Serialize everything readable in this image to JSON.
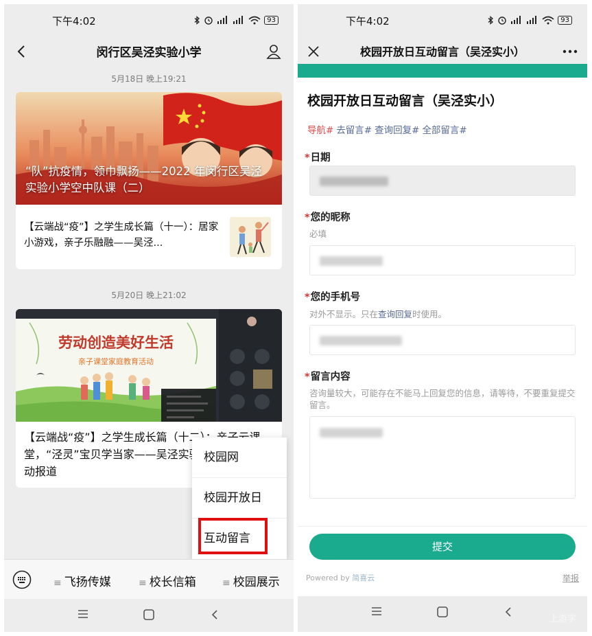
{
  "status_bar": {
    "time": "下午4:02",
    "battery": "93"
  },
  "left_screen": {
    "header": {
      "title": "闵行区吴泾实验小学"
    },
    "messages": [
      {
        "timestamp": "5月18日 晚上19:21",
        "hero_title": "“队”抗疫情，领巾飘扬——2022 年闵行区吴泾实验小学空中队课（二）",
        "sub_title": "【云端战“疫”】之学生成长篇（十一）：居家小游戏，亲子乐融融——吴泾..."
      },
      {
        "timestamp": "5月20日 晚上21:02",
        "hero_image_title": "劳动创造美好生活",
        "hero_image_subtitle": "亲子课堂家庭教育活动",
        "body_title": "【云端战“疫”】之学生成长篇（十二）：亲子云课堂，“泾灵”宝贝学当家——吴泾实验小学家校共育活动报道"
      }
    ],
    "popup_menu": [
      "校园网",
      "校园开放日",
      "互动留言"
    ],
    "bottom_menu": [
      "飞扬传媒",
      "校长信箱",
      "校园展示"
    ]
  },
  "right_screen": {
    "header": {
      "title": "校园开放日互动留言（吴泾实小）"
    },
    "form_title": "校园开放日互动留言（吴泾实小）",
    "quick_links": [
      "导航#",
      "去留言#",
      "查询回复#",
      "全部留言#"
    ],
    "fields": [
      {
        "label": "日期",
        "required": true,
        "hint": ""
      },
      {
        "label": "您的昵称",
        "required": true,
        "hint": "必填"
      },
      {
        "label": "您的手机号",
        "required": true,
        "hint_pre": "对外不显示。只在",
        "hint_link": "查询回复",
        "hint_post": "时使用。"
      },
      {
        "label": "留言内容",
        "required": true,
        "hint": "咨询量较大，可能存在不能马上回复您的信息，请等待，不要重复提交留言。"
      }
    ],
    "submit_label": "提交",
    "powered_by_prefix": "Powered by",
    "powered_by_brand": "简喜云",
    "report_label": "举报",
    "watermark": "上游学"
  },
  "colors": {
    "accent": "#1aaa8e",
    "highlight": "#e01010",
    "link": "#576b95"
  }
}
